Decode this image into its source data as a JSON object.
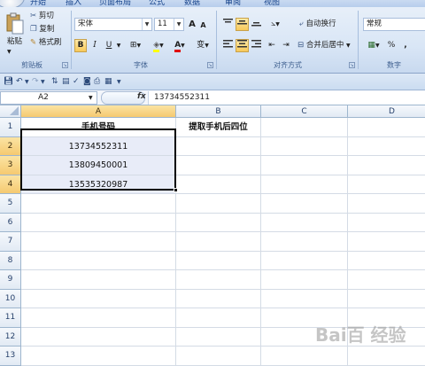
{
  "tabs": [
    "开始",
    "插入",
    "页面布局",
    "公式",
    "数据",
    "审阅",
    "视图"
  ],
  "clipboard": {
    "paste": "粘贴",
    "cut": "剪切",
    "copy": "复制",
    "format_painter": "格式刷",
    "label": "剪贴板"
  },
  "font": {
    "name": "宋体",
    "size": "11",
    "bold": "B",
    "italic": "I",
    "underline": "U",
    "grow": "A",
    "shrink": "A",
    "font_color_letter": "A",
    "phonetic": "变",
    "label": "字体"
  },
  "alignment": {
    "wrap_text": "自动换行",
    "merge_center": "合并后居中",
    "label": "对齐方式"
  },
  "number": {
    "format": "常规",
    "percent": "%",
    "comma": ",",
    "label": "数字"
  },
  "formula_bar": {
    "name_box": "A2",
    "fx": "fx",
    "content": "13734552311"
  },
  "sheet": {
    "columns": [
      "A",
      "B",
      "C",
      "D"
    ],
    "rows": [
      "1",
      "2",
      "3",
      "4",
      "5",
      "6",
      "7",
      "8",
      "9",
      "10",
      "11",
      "12",
      "13"
    ],
    "cells": {
      "A1": "手机号码",
      "B1": "提取手机后四位",
      "A2": "13734552311",
      "A3": "13809450001",
      "A4": "13535320987"
    }
  },
  "watermark": "Bai百 经验",
  "colors": {
    "ribbon_top": "#e7eff9",
    "selection_header": "#f5c970",
    "selected_range": "#e8ecf8"
  }
}
